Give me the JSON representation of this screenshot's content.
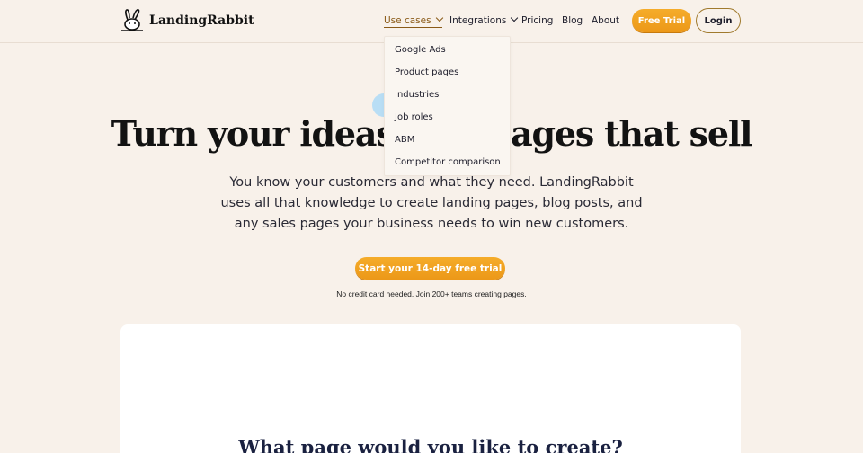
{
  "brand": {
    "name": "LandingRabbit"
  },
  "nav": {
    "items": [
      {
        "label": "Use cases",
        "has_dropdown": true,
        "active": true
      },
      {
        "label": "Integrations",
        "has_dropdown": true,
        "active": false
      },
      {
        "label": "Pricing",
        "has_dropdown": false,
        "active": false
      },
      {
        "label": "Blog",
        "has_dropdown": false,
        "active": false
      },
      {
        "label": "About",
        "has_dropdown": false,
        "active": false
      }
    ],
    "trial_label": "Free Trial",
    "login_label": "Login"
  },
  "dropdown": {
    "items": [
      "Google Ads",
      "Product pages",
      "Industries",
      "Job roles",
      "ABM",
      "Competitor comparison"
    ]
  },
  "hero": {
    "title": "Turn your ideas into pages that sell",
    "subtitle": "You know your customers and what they need. LandingRabbit uses all that knowledge to create landing pages, blog posts, and any sales pages your business needs to win new customers.",
    "cta_label": "Start your 14-day free trial",
    "note": "No credit card needed. Join 200+ teams creating pages."
  },
  "card": {
    "title": "What page would you like to create?"
  },
  "colors": {
    "accent": "#f0a020",
    "background": "#f8f1ea",
    "nav_active": "#8a5a17"
  },
  "icons": {
    "logo": "rabbit-icon",
    "nav_dropdown": "chevron-down-icon"
  }
}
